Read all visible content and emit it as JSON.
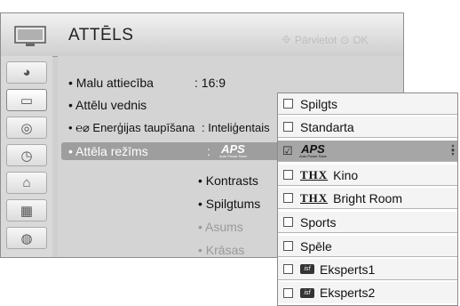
{
  "header": {
    "title": "ATTĒLS",
    "hint_label": "Pārvietot",
    "hint_ok": "OK"
  },
  "sidebar": {
    "items": [
      {
        "icon": "satellite-dish-icon",
        "glyph": "◕"
      },
      {
        "icon": "tv-picture-icon",
        "glyph": "▭"
      },
      {
        "icon": "speaker-icon",
        "glyph": "◎"
      },
      {
        "icon": "clock-icon",
        "glyph": "◷"
      },
      {
        "icon": "lock-icon",
        "glyph": "⌂"
      },
      {
        "icon": "keyboard-icon",
        "glyph": "▦"
      },
      {
        "icon": "globe-icon",
        "glyph": "◍"
      }
    ]
  },
  "menu": {
    "aspect": {
      "label": "• Malu attiecība",
      "value": ": 16:9"
    },
    "wizard": {
      "label": "• Attēlu vednis"
    },
    "energy": {
      "label": "• ℮⌀ Enerģijas taupīšana",
      "value": ": Inteliģentais"
    },
    "mode": {
      "label": "• Attēla režīms",
      "colon": ":",
      "aps_big": "APS",
      "aps_small": "Auto Power Save"
    },
    "sub_items": [
      {
        "label": "• Kontrasts",
        "dim": false
      },
      {
        "label": "• Spilgtums",
        "dim": false
      },
      {
        "label": "• Asums",
        "dim": true
      },
      {
        "label": "• Krāsas",
        "dim": true
      }
    ]
  },
  "dropdown": {
    "options": [
      {
        "label": "Spilgts",
        "badge": "",
        "checked": false,
        "selected": false
      },
      {
        "label": "Standarta",
        "badge": "",
        "checked": false,
        "selected": false
      },
      {
        "label": "",
        "badge": "aps",
        "checked": true,
        "selected": true
      },
      {
        "label": "Kino",
        "badge": "THX",
        "checked": false,
        "selected": false
      },
      {
        "label": "Bright Room",
        "badge": "THX",
        "checked": false,
        "selected": false
      },
      {
        "label": "Sports",
        "badge": "",
        "checked": false,
        "selected": false
      },
      {
        "label": "Spēle",
        "badge": "",
        "checked": false,
        "selected": false
      },
      {
        "label": "Eksperts1",
        "badge": "isf",
        "checked": false,
        "selected": false
      },
      {
        "label": "Eksperts2",
        "badge": "isf",
        "checked": false,
        "selected": false
      }
    ],
    "check_glyph": "☑",
    "aps_big": "APS",
    "aps_small": "Auto Power Save",
    "isf_text": "isf"
  }
}
